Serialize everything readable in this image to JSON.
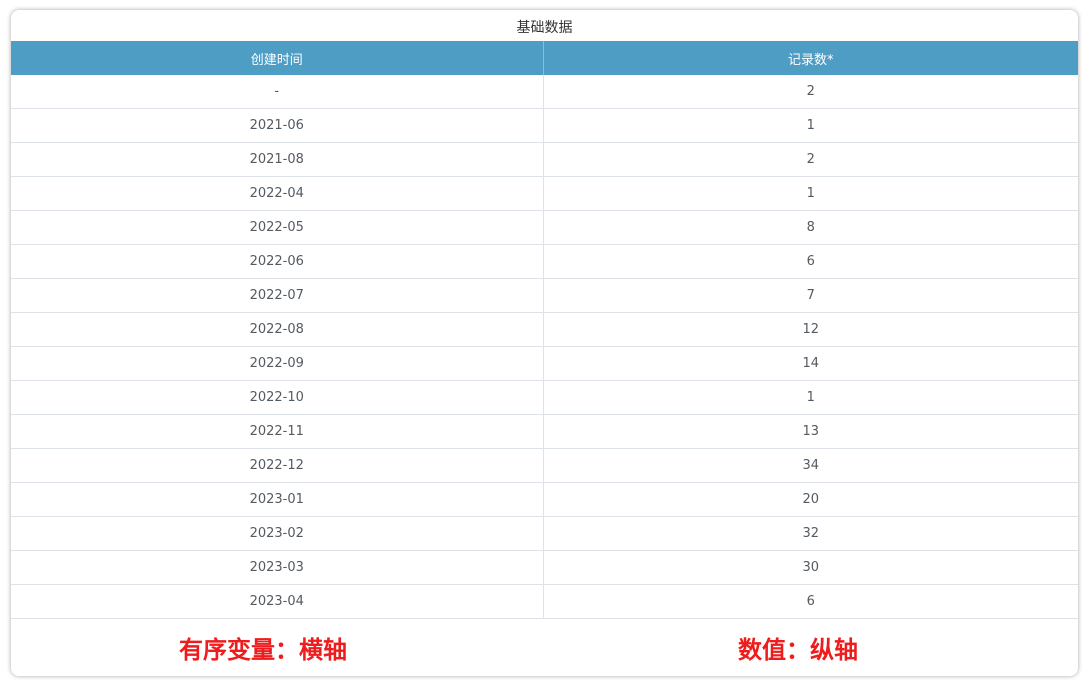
{
  "panel": {
    "title": "基础数据"
  },
  "table": {
    "columns": [
      "创建时间",
      "记录数*"
    ],
    "rows": [
      [
        "-",
        "2"
      ],
      [
        "2021-06",
        "1"
      ],
      [
        "2021-08",
        "2"
      ],
      [
        "2022-04",
        "1"
      ],
      [
        "2022-05",
        "8"
      ],
      [
        "2022-06",
        "6"
      ],
      [
        "2022-07",
        "7"
      ],
      [
        "2022-08",
        "12"
      ],
      [
        "2022-09",
        "14"
      ],
      [
        "2022-10",
        "1"
      ],
      [
        "2022-11",
        "13"
      ],
      [
        "2022-12",
        "34"
      ],
      [
        "2023-01",
        "20"
      ],
      [
        "2023-02",
        "32"
      ],
      [
        "2023-03",
        "30"
      ],
      [
        "2023-04",
        "6"
      ]
    ]
  },
  "annotations": {
    "left": "有序变量：横轴",
    "right": "数值：纵轴"
  },
  "colors": {
    "header_bg": "#4d9dc4",
    "annotation_text": "#ee1c1c"
  }
}
